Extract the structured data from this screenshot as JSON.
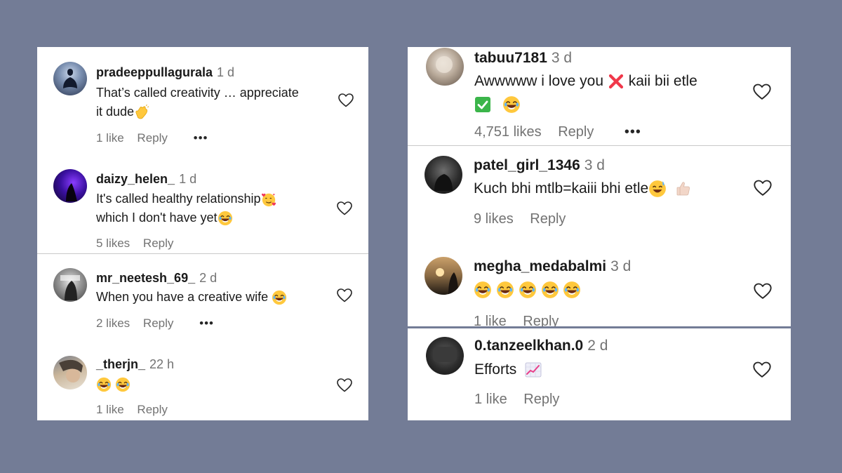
{
  "left_panel": {
    "comments": [
      {
        "username": "pradeeppullagurala",
        "age": "1 d",
        "text_line1": "That’s called creativity … appreciate",
        "text_line2": "it dude",
        "likes": "1 like",
        "reply": "Reply",
        "more": "•••"
      },
      {
        "username": "daizy_helen_",
        "age": "1 d",
        "text_line1": "It's called healthy relationship",
        "text_line2": "which I don't have yet",
        "likes": "5 likes",
        "reply": "Reply"
      },
      {
        "username": "mr_neetesh_69_",
        "age": "2 d",
        "text_line1": "When you have a creative wife",
        "likes": "2 likes",
        "reply": "Reply",
        "more": "•••"
      },
      {
        "username": "_therjn_",
        "age": "22 h",
        "likes": "1 like",
        "reply": "Reply"
      }
    ]
  },
  "right_panel": {
    "comments": [
      {
        "username": "tabuu7181",
        "age": "3 d",
        "text_line1": "Awwwww i love you",
        "text_line1b": "kaii bii etle",
        "likes": "4,751 likes",
        "reply": "Reply",
        "more": "•••"
      },
      {
        "username": "patel_girl_1346",
        "age": "3 d",
        "text_line1": "Kuch bhi mtlb=kaiii bhi etle",
        "likes": "9 likes",
        "reply": "Reply"
      },
      {
        "username": "megha_medabalmi",
        "age": "3 d",
        "likes": "1 like",
        "reply": "Reply"
      },
      {
        "username": "0.tanzeelkhan.0",
        "age": "2 d",
        "text_line1": "Efforts",
        "likes": "1 like",
        "reply": "Reply"
      }
    ]
  },
  "colors": {
    "background": "#737c96",
    "panel": "#ffffff",
    "muted": "#737373",
    "text": "#1a1a1a"
  },
  "icons": [
    "heart-outline-icon",
    "laughing-emoji",
    "clapping-hands-emoji",
    "smiling-hearts-emoji",
    "cross-mark-emoji",
    "check-mark-emoji",
    "sweat-smile-emoji",
    "thumbs-up-emoji",
    "chart-increasing-emoji"
  ]
}
